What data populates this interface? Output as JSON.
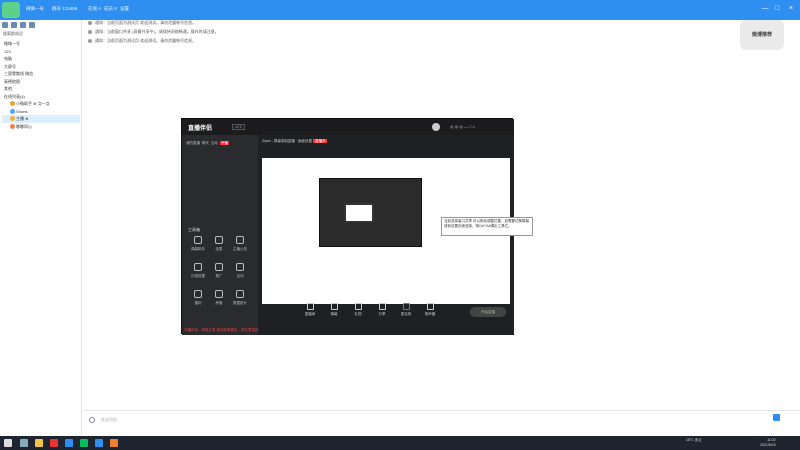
{
  "titlebar": {
    "group": "微微一号",
    "meta1": "群号 123456",
    "meta2": "在线 4",
    "meta3": "成员 8",
    "meta4": "设置",
    "minimize": "—",
    "maximize": "□",
    "close": "×"
  },
  "sidebar": {
    "search_label": "搜索群成员",
    "tree": [
      {
        "label": "微微一号",
        "level": 0
      },
      {
        "label": "123",
        "level": 0
      },
      {
        "label": "电脑",
        "level": 0
      },
      {
        "label": "大屏号",
        "level": 0
      },
      {
        "label": "三国零散线 微信",
        "level": 0
      },
      {
        "label": "高德地图",
        "level": 0
      },
      {
        "label": "其他",
        "level": 0
      },
      {
        "label": "在线列表(4)",
        "level": 0
      },
      {
        "label": "小微助手 ⊕ 点一点",
        "level": 1,
        "color": "#f0a030"
      },
      {
        "label": "Shorts",
        "level": 1,
        "color": "#4aa3ff"
      },
      {
        "label": "主播 ⊕",
        "level": 1,
        "color": "#f0b040",
        "selected": true
      },
      {
        "label": "嘟嘟同心",
        "level": 1,
        "color": "#f08050"
      }
    ]
  },
  "chat": {
    "notices": [
      "通知：当前页面为测试页 欢迎测试。请勿泄露帐号信息。",
      "通知：当前窗口共享 (屏幕共享中)，请保持网络畅通，操作时请注意。",
      "通知：当前页面为测试页 欢迎测试。请勿泄露帐号信息。"
    ],
    "watermark": "微博推荐",
    "input_placeholder": "发送消息..."
  },
  "stream": {
    "app_name": "直播伴侣",
    "version": "v2.9",
    "left_tabs": [
      "我的直播",
      "聊天",
      "互动",
      "设置"
    ],
    "live_btn": "开播",
    "section_title": "工具箱",
    "tools": [
      {
        "label": "弹幕助手"
      },
      {
        "label": "连麦"
      },
      {
        "label": "主播公告"
      },
      {
        "label": "礼物设置"
      },
      {
        "label": "推广"
      },
      {
        "label": "活动"
      },
      {
        "label": "福利"
      },
      {
        "label": "房管"
      },
      {
        "label": "数据统计"
      }
    ],
    "status_text": "开播状态：网络正常 推流帧率稳定，请注意保持",
    "title_text": "Zipan - 屏幕录制直播 · 画面设置",
    "title_badge": "直播中",
    "bottom_buttons": [
      "直播间",
      "弹幕",
      "礼物",
      "分享",
      "麦克风",
      "扬声器"
    ],
    "start_btn": "开始直播",
    "tooltip": "当前选择窗口共享 可以拖动调整位置，如需要切换屏幕请到设置页面选择，按Ctrl+Alt调出工具栏。"
  },
  "taskbar": {
    "weather": "18°C 多云",
    "time": "11:02",
    "date": "2021/6/16",
    "apps": [
      "搜索",
      "任务视图",
      "文件夹",
      "浏览器",
      "微信",
      "直播伴侣"
    ]
  }
}
